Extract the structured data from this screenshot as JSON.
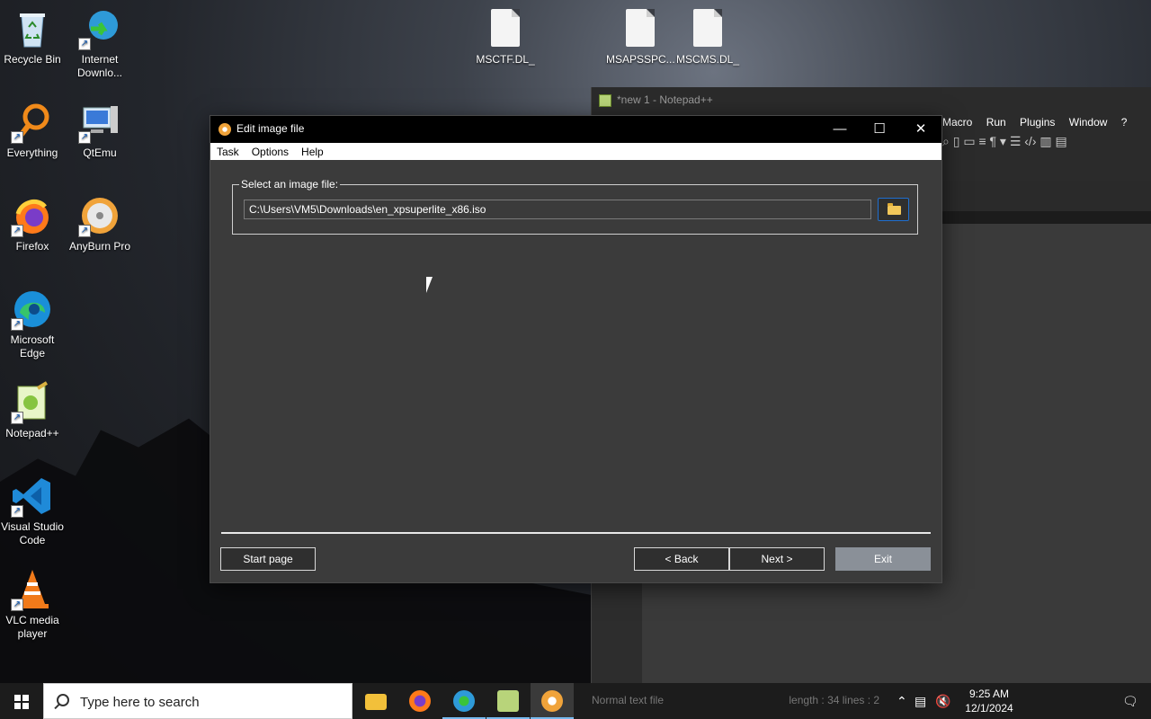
{
  "desktop": {
    "icons": [
      {
        "label": "Recycle Bin",
        "icon": "recycle-bin-icon"
      },
      {
        "label": "Internet Downlo...",
        "icon": "internet-download-manager-icon"
      },
      {
        "label": "Everything",
        "icon": "everything-search-icon"
      },
      {
        "label": "QtEmu",
        "icon": "qtemu-icon"
      },
      {
        "label": "Firefox",
        "icon": "firefox-icon"
      },
      {
        "label": "AnyBurn Pro",
        "icon": "anyburn-icon"
      },
      {
        "label": "Microsoft Edge",
        "icon": "edge-icon"
      },
      {
        "label": "Notepad++",
        "icon": "notepadpp-icon"
      },
      {
        "label": "Visual Studio Code",
        "icon": "vscode-icon"
      },
      {
        "label": "VLC media player",
        "icon": "vlc-icon"
      }
    ],
    "files": [
      {
        "label": "MSCTF.DL_"
      },
      {
        "label": "MSAPSSPC..."
      },
      {
        "label": "MSCMS.DL_"
      }
    ]
  },
  "notepad": {
    "title": "*new 1 - Notepad++",
    "menu": [
      "Macro",
      "Run",
      "Plugins",
      "Window",
      "?"
    ],
    "status": "Normal text file",
    "status_right": "length : 34    lines : 2"
  },
  "dialog": {
    "title": "Edit image file",
    "menu": [
      "Task",
      "Options",
      "Help"
    ],
    "group_label": "Select an image file:",
    "path_value": "C:\\Users\\VM5\\Downloads\\en_xpsuperlite_x86.iso",
    "buttons": {
      "start_page": "Start page",
      "back": "< Back",
      "next": "Next >",
      "exit": "Exit"
    }
  },
  "taskbar": {
    "search_placeholder": "Type here to search",
    "time": "9:25 AM",
    "date": "12/1/2024"
  },
  "colors": {
    "dialog_bg": "#3b3b3b",
    "accent": "#1f6fd0",
    "exit_disabled": "#8a9098"
  }
}
